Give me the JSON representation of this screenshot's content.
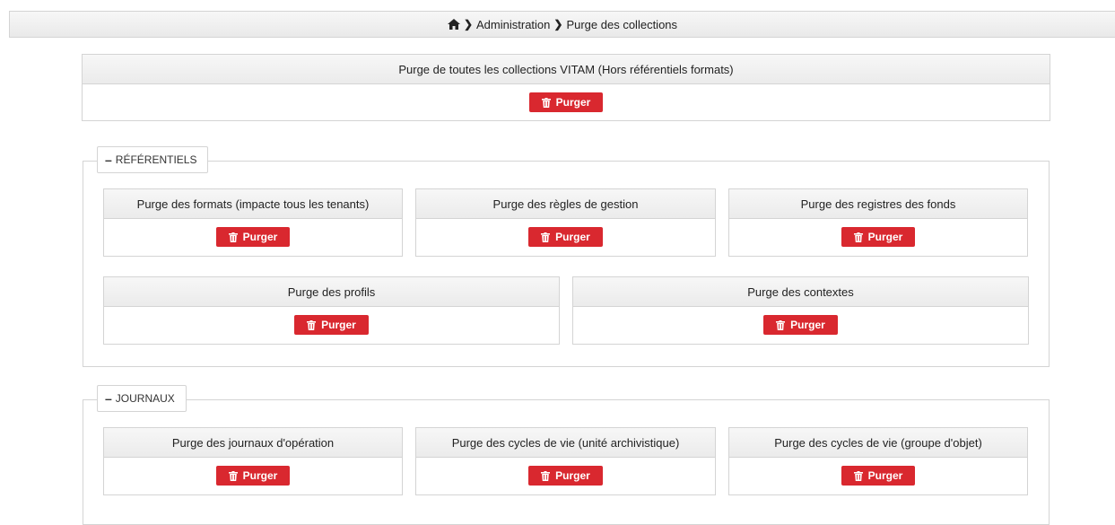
{
  "breadcrumb": {
    "home_icon": "home-icon",
    "sep": "❯",
    "item1": "Administration",
    "item2": "Purge des collections"
  },
  "button_label": "Purger",
  "button_icon": "trash-icon",
  "colors": {
    "danger": "#d9282f"
  },
  "global": {
    "title": "Purge de toutes les collections VITAM (Hors référentiels formats)"
  },
  "referentiels": {
    "legend": "RÉFÉRENTIELS",
    "panels": [
      "Purge des formats (impacte tous les tenants)",
      "Purge des règles de gestion",
      "Purge des registres des fonds",
      "Purge des profils",
      "Purge des contextes"
    ]
  },
  "journaux": {
    "legend": "JOURNAUX",
    "panels": [
      "Purge des journaux d'opération",
      "Purge des cycles de vie (unité archivistique)",
      "Purge des cycles de vie (groupe d'objet)"
    ]
  }
}
